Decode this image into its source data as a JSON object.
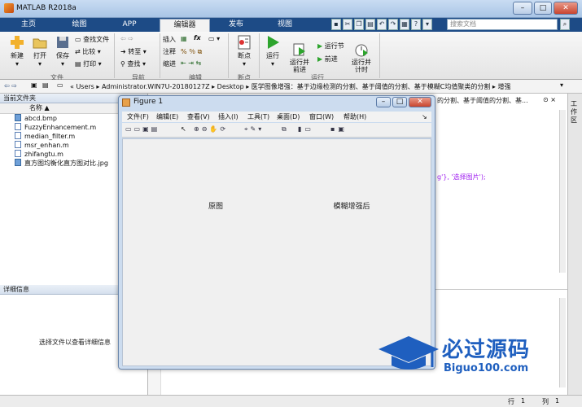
{
  "window": {
    "title": "MATLAB R2018a"
  },
  "tabs": [
    "主页",
    "绘图",
    "APP",
    "编辑器",
    "发布",
    "视图"
  ],
  "search": {
    "placeholder": "搜索文档"
  },
  "ribbon": {
    "file": {
      "new": "新建",
      "open": "打开",
      "save": "保存",
      "find_files": "查找文件",
      "compare": "比较",
      "print": "打印",
      "group": "文件"
    },
    "nav": {
      "goto": "转至",
      "find": "查找",
      "group": "导航"
    },
    "edit": {
      "insert": "插入",
      "comment": "注释",
      "indent": "缩进",
      "fx": "fx",
      "group": "编辑"
    },
    "breakpoint": {
      "label": "断点",
      "group": "断点"
    },
    "run": {
      "run": "运行",
      "run_advance": "运行并\n前进",
      "run_section": "运行节",
      "advance": "前进",
      "run_time": "运行并\n计时",
      "group": "运行"
    }
  },
  "address": {
    "path": "«  Users  ▸  Administrator.WIN7U-20180127Z  ▸  Desktop  ▸  医学图像增强：基于边缘检测的分割、基于阈值的分割、基于模糊C均值聚类的分割  ▸  增强"
  },
  "left_panel": {
    "title": "当前文件夹",
    "col_name": "名称 ▲",
    "files": [
      {
        "name": "abcd.bmp",
        "kind": "image"
      },
      {
        "name": "FuzzyEnhancement.m",
        "kind": "m"
      },
      {
        "name": "median_filter.m",
        "kind": "m"
      },
      {
        "name": "msr_enhan.m",
        "kind": "m"
      },
      {
        "name": "zhifangtu.m",
        "kind": "m"
      },
      {
        "name": "直方图均衡化直方图对比.jpg",
        "kind": "image"
      }
    ],
    "details_title": "详细信息",
    "details_hint": "选择文件以查看详细信息"
  },
  "editor": {
    "path_fragment": "的分割、基于阈值的分割、基...",
    "code_fragment": "g'}, '选择图片');"
  },
  "side": {
    "label": "工作区"
  },
  "status": {
    "row_label": "行",
    "row": "1",
    "col_label": "列",
    "col": "1"
  },
  "figure": {
    "title": "Figure 1",
    "menu": [
      "文件(F)",
      "编辑(E)",
      "查看(V)",
      "插入(I)",
      "工具(T)",
      "桌面(D)",
      "窗口(W)",
      "帮助(H)"
    ],
    "axes_titles": [
      "原图",
      "模糊增强后"
    ]
  },
  "watermark": {
    "cn": "必过源码",
    "en": "Biguo100.com"
  },
  "colors": {
    "tabbar": "#1d4b86",
    "accent": "#1f5fbf"
  }
}
